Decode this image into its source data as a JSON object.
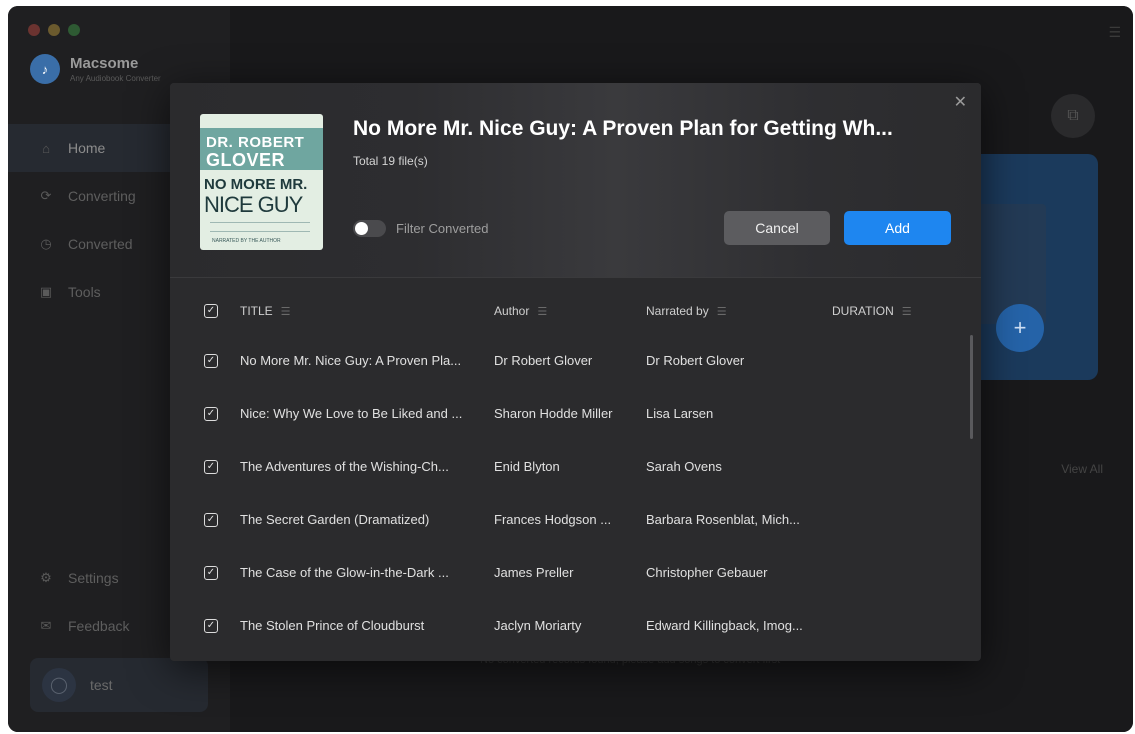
{
  "app": {
    "name": "Macsome",
    "subtitle": "Any Audiobook Converter",
    "traffic_colors": [
      "#ff5f57",
      "#febc2e",
      "#28c840"
    ]
  },
  "sidebar": {
    "items": [
      {
        "label": "Home",
        "icon": "home-icon",
        "active": true
      },
      {
        "label": "Converting",
        "icon": "sync-icon",
        "active": false
      },
      {
        "label": "Converted",
        "icon": "clock-icon",
        "active": false
      },
      {
        "label": "Tools",
        "icon": "toolbox-icon",
        "active": false
      }
    ],
    "bottom": [
      {
        "label": "Settings",
        "icon": "gear-icon"
      },
      {
        "label": "Feedback",
        "icon": "mail-icon"
      }
    ],
    "user": {
      "name": "test"
    }
  },
  "main": {
    "view_all": "View All",
    "empty_text": "No converted records found, please add songs to convert first"
  },
  "dialog": {
    "title": "No More Mr. Nice Guy: A Proven Plan for Getting Wh...",
    "subtitle": "Total 19 file(s)",
    "filter_label": "Filter Converted",
    "filter_on": false,
    "cancel": "Cancel",
    "add": "Add",
    "cover": {
      "line1": "DR. ROBERT",
      "line2": "GLOVER",
      "line3": "NO MORE MR.",
      "line4": "NICE GUY",
      "line5": "NARRATED BY THE AUTHOR"
    },
    "columns": {
      "title": "TITLE",
      "author": "Author",
      "narrated": "Narrated by",
      "duration": "DURATION"
    },
    "rows": [
      {
        "title": "No More Mr. Nice Guy: A Proven Pla...",
        "author": "Dr Robert Glover",
        "narrated": "Dr Robert Glover",
        "duration": ""
      },
      {
        "title": "Nice: Why We Love to Be Liked and ...",
        "author": "Sharon Hodde Miller",
        "narrated": "Lisa Larsen",
        "duration": ""
      },
      {
        "title": "The Adventures of the Wishing-Ch...",
        "author": "Enid Blyton",
        "narrated": "Sarah Ovens",
        "duration": ""
      },
      {
        "title": "The Secret Garden (Dramatized)",
        "author": "Frances Hodgson ...",
        "narrated": "Barbara Rosenblat, Mich...",
        "duration": ""
      },
      {
        "title": "The Case of the Glow-in-the-Dark ...",
        "author": "James Preller",
        "narrated": "Christopher Gebauer",
        "duration": ""
      },
      {
        "title": "The Stolen Prince of Cloudburst",
        "author": "Jaclyn Moriarty",
        "narrated": "Edward Killingback, Imog...",
        "duration": ""
      }
    ]
  },
  "colors": {
    "accent": "#1e86f0",
    "dialog_bg": "#2b2b2d",
    "sidebar_bg": "#1f1f21"
  }
}
